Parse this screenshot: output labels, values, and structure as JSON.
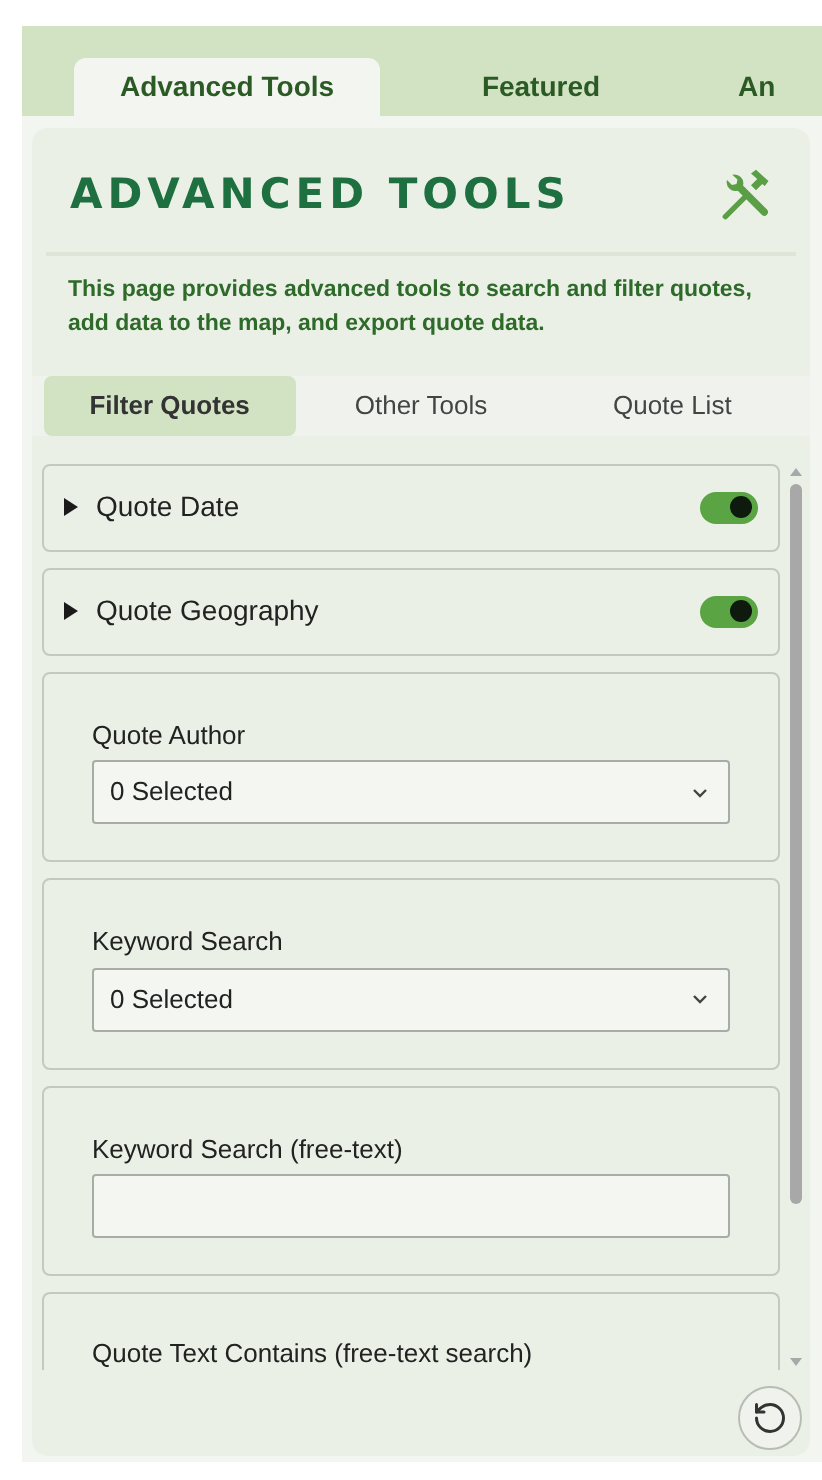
{
  "tabs": [
    {
      "label": "Advanced Tools",
      "selected": true
    },
    {
      "label": "Featured",
      "selected": false
    },
    {
      "label": "An",
      "selected": false
    }
  ],
  "panel": {
    "title": "ADVANCED TOOLS",
    "description": "This page provides advanced tools to search and filter quotes, add data to the map, and export quote data."
  },
  "subtabs": [
    {
      "label": "Filter Quotes",
      "selected": true
    },
    {
      "label": "Other Tools",
      "selected": false
    },
    {
      "label": "Quote List",
      "selected": false
    }
  ],
  "filters": [
    {
      "kind": "toggle",
      "label": "Quote Date",
      "expanded": false,
      "on": true
    },
    {
      "kind": "toggle",
      "label": "Quote Geography",
      "expanded": false,
      "on": true
    },
    {
      "kind": "select",
      "label": "Quote Author",
      "value": "0 Selected"
    },
    {
      "kind": "select",
      "label": "Keyword Search",
      "value": "0 Selected"
    },
    {
      "kind": "text",
      "label": "Keyword Search (free-text)"
    },
    {
      "kind": "label",
      "label": "Quote Text Contains (free-text search)"
    }
  ]
}
